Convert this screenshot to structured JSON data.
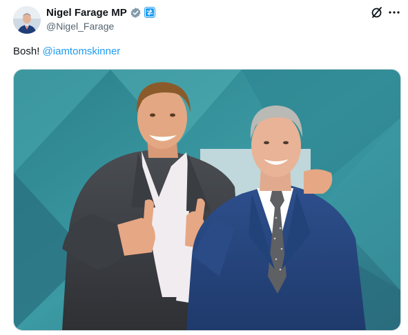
{
  "tweet": {
    "author_name": "Nigel Farage MP",
    "handle": "@Nigel_Farage",
    "text_prefix": "Bosh! ",
    "mention": "@iamtomskinner"
  },
  "icons": {
    "verified": "verified-badge-icon",
    "affiliation": "affiliation-badge-icon",
    "grok": "grok-icon",
    "more": "more-icon"
  },
  "colors": {
    "link": "#1d9bf0",
    "handle": "#536471",
    "verified_badge": "#829aab"
  }
}
